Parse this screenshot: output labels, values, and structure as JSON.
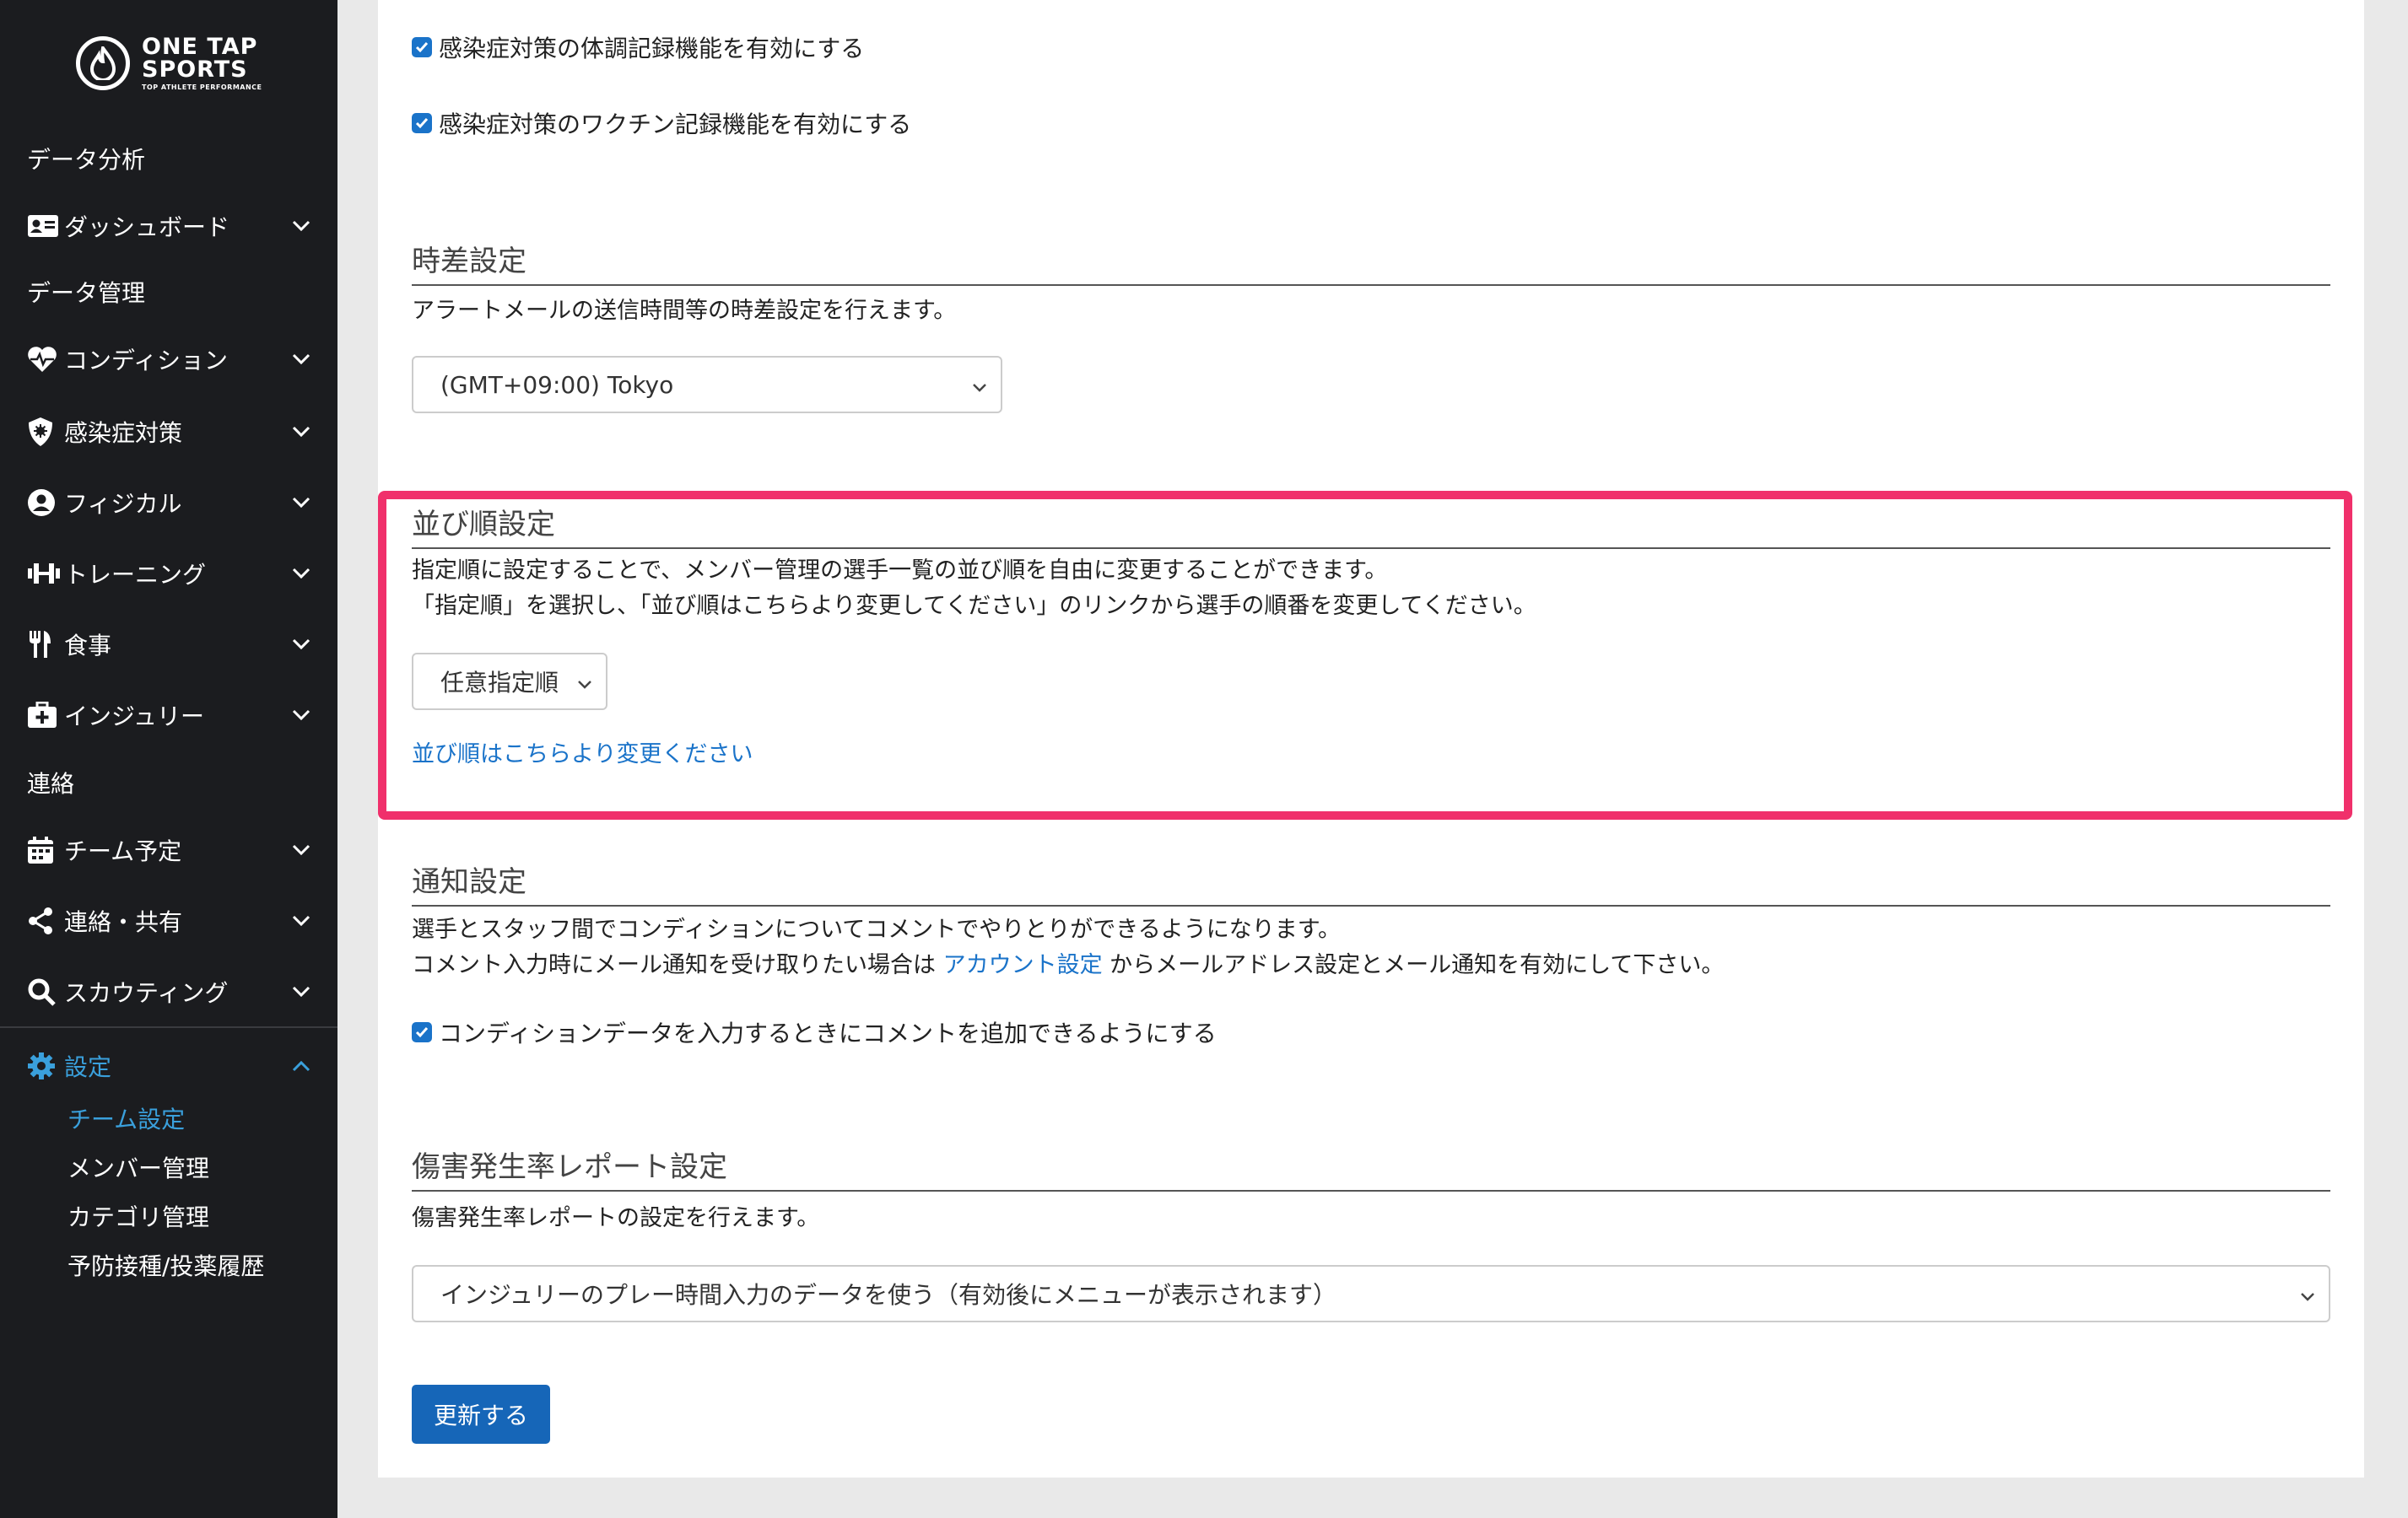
{
  "brand": {
    "line1": "ONE TAP",
    "line2": "SPORTS",
    "tagline": "TOP ATHLETE PERFORMANCE"
  },
  "sidebar": {
    "sections": [
      "データ分析",
      "データ管理",
      "連絡"
    ],
    "items": [
      {
        "label": "ダッシュボード",
        "icon": "id-card-icon"
      },
      {
        "label": "コンディション",
        "icon": "heart-pulse-icon"
      },
      {
        "label": "感染症対策",
        "icon": "shield-virus-icon"
      },
      {
        "label": "フィジカル",
        "icon": "user-circle-icon"
      },
      {
        "label": "トレーニング",
        "icon": "dumbbell-icon"
      },
      {
        "label": "食事",
        "icon": "utensils-icon"
      },
      {
        "label": "インジュリー",
        "icon": "first-aid-icon"
      },
      {
        "label": "チーム予定",
        "icon": "calendar-icon"
      },
      {
        "label": "連絡・共有",
        "icon": "share-icon"
      },
      {
        "label": "スカウティング",
        "icon": "search-icon"
      },
      {
        "label": "設定",
        "icon": "gear-icon"
      }
    ],
    "settings_sub": [
      "チーム設定",
      "メンバー管理",
      "カテゴリ管理",
      "予防接種/投薬履歴"
    ]
  },
  "infection": {
    "check1": "感染症対策の体調記録機能を有効にする",
    "check2": "感染症対策のワクチン記録機能を有効にする"
  },
  "timezone": {
    "title": "時差設定",
    "desc": "アラートメールの送信時間等の時差設定を行えます。",
    "value": "(GMT+09:00) Tokyo"
  },
  "sort": {
    "title": "並び順設定",
    "desc1": "指定順に設定することで、メンバー管理の選手一覧の並び順を自由に変更することができます。",
    "desc2": "「指定順」を選択し、「並び順はこちらより変更してください」のリンクから選手の順番を変更してください。",
    "value": "任意指定順",
    "link": "並び順はこちらより変更ください"
  },
  "notify": {
    "title": "通知設定",
    "desc1": "選手とスタッフ間でコンディションについてコメントでやりとりができるようになります。",
    "desc2_pre": "コメント入力時にメール通知を受け取りたい場合は ",
    "desc2_link": "アカウント設定",
    "desc2_post": " からメールアドレス設定とメール通知を有効にして下さい。",
    "check": "コンディションデータを入力するときにコメントを追加できるようにする"
  },
  "injury": {
    "title": "傷害発生率レポート設定",
    "desc": "傷害発生率レポートの設定を行えます。",
    "value": "インジュリーのプレー時間入力のデータを使う（有効後にメニューが表示されます）"
  },
  "submit": "更新する",
  "colors": {
    "accent": "#1a73c9",
    "highlight": "#f0306b",
    "sidebar": "#1b1c1f",
    "active": "#3aa0dc"
  }
}
